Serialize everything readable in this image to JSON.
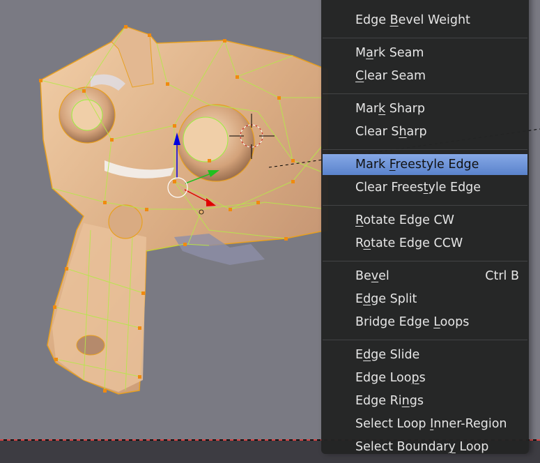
{
  "viewport": {
    "mode": "edit-mode",
    "object": "Suzanne mesh",
    "colors": {
      "background": "#7a7a83",
      "mesh_surface": "#e0b690",
      "wire": "#e8a020",
      "wire_highlight": "#9cf040",
      "vertex": "#f08a10",
      "gizmo_x": "#e00000",
      "gizmo_y": "#20c020",
      "gizmo_z": "#0000e0"
    }
  },
  "menu": {
    "items": [
      {
        "label_pre": "Edge ",
        "label_key": "B",
        "label_post": "evel Weight",
        "group": 0
      },
      {
        "label_pre": "M",
        "label_key": "a",
        "label_post": "rk Seam",
        "group": 1
      },
      {
        "label_pre": "",
        "label_key": "C",
        "label_post": "lear Seam",
        "group": 1
      },
      {
        "label_pre": "Mar",
        "label_key": "k",
        "label_post": " Sharp",
        "group": 2
      },
      {
        "label_pre": "Clear S",
        "label_key": "h",
        "label_post": "arp",
        "group": 2
      },
      {
        "label_pre": "Mark ",
        "label_key": "F",
        "label_post": "reestyle Edge",
        "group": 3,
        "active": true
      },
      {
        "label_pre": "Clear Frees",
        "label_key": "t",
        "label_post": "yle Edge",
        "group": 3
      },
      {
        "label_pre": "",
        "label_key": "R",
        "label_post": "otate Edge CW",
        "group": 4
      },
      {
        "label_pre": "R",
        "label_key": "o",
        "label_post": "tate Edge CCW",
        "group": 4
      },
      {
        "label_pre": "Be",
        "label_key": "v",
        "label_post": "el",
        "group": 5,
        "shortcut": "Ctrl B"
      },
      {
        "label_pre": "E",
        "label_key": "d",
        "label_post": "ge Split",
        "group": 5
      },
      {
        "label_pre": "Bridge Edge ",
        "label_key": "L",
        "label_post": "oops",
        "group": 5
      },
      {
        "label_pre": "E",
        "label_key": "d",
        "label_post": "ge Slide",
        "group": 6
      },
      {
        "label_pre": "Edge Loo",
        "label_key": "p",
        "label_post": "s",
        "group": 6
      },
      {
        "label_pre": "Edge Ri",
        "label_key": "n",
        "label_post": "gs",
        "group": 6
      },
      {
        "label_pre": "Select Loop ",
        "label_key": "I",
        "label_post": "nner-Region",
        "group": 6
      },
      {
        "label_pre": "Select Boundar",
        "label_key": "y",
        "label_post": " Loop",
        "group": 6
      }
    ],
    "active_item": "Mark Freestyle Edge"
  }
}
